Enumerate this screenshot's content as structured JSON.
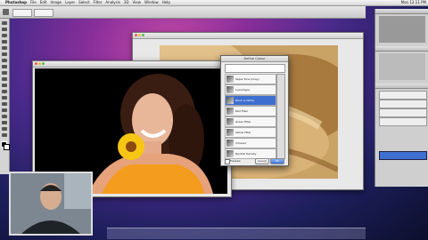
{
  "menubar": {
    "items": [
      "Photoshop",
      "File",
      "Edit",
      "Image",
      "Layer",
      "Select",
      "Filter",
      "Analysis",
      "3D",
      "View",
      "Window",
      "Help"
    ],
    "clock": "Mon 12:11 PM"
  },
  "dialog": {
    "title": "Define Colour",
    "presets": [
      "Sepia Tone (Gray)",
      "Cyanotype",
      "Black & White",
      "Red Filter",
      "Green Filter",
      "Yellow Filter",
      "Infrared",
      "Neutral Density"
    ],
    "buttons": [
      "OK",
      "Cancel"
    ],
    "checkbox": "Preview"
  },
  "colors": {
    "selection": "#3e6fd0"
  }
}
